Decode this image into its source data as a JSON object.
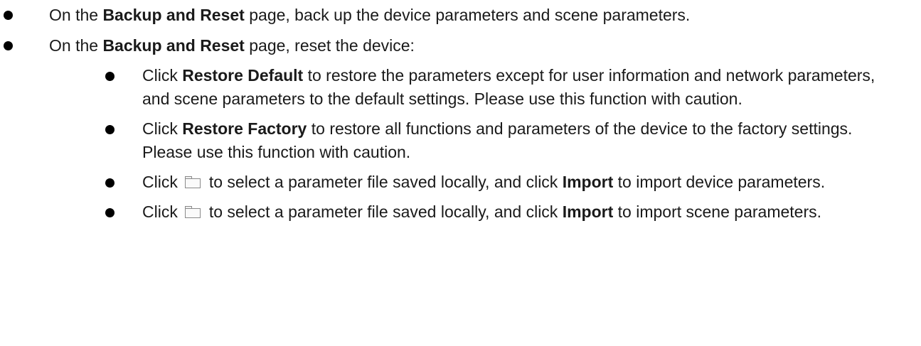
{
  "items": [
    {
      "pre": "On the ",
      "bold": "Backup and Reset",
      "post": " page, back up the device parameters and scene parameters."
    },
    {
      "pre": "On the ",
      "bold": "Backup and Reset",
      "post": " page, reset the device:",
      "subitems": [
        {
          "pre": "Click ",
          "bold": "Restore Default",
          "post": " to restore the parameters except for user information and network parameters, and scene parameters to the default settings. Please use this function with caution."
        },
        {
          "pre": "Click ",
          "bold": "Restore Factory",
          "post": " to restore all functions and parameters of the device to the factory settings. Please use this function with caution."
        },
        {
          "pre": "Click",
          "icon": "folder-icon",
          "mid": "to select a parameter file saved locally, and click ",
          "bold": "Import",
          "post": " to import device parameters."
        },
        {
          "pre": "Click",
          "icon": "folder-icon",
          "mid": "to select a parameter file saved locally, and click ",
          "bold": "Import",
          "post": " to import scene parameters."
        }
      ]
    }
  ]
}
